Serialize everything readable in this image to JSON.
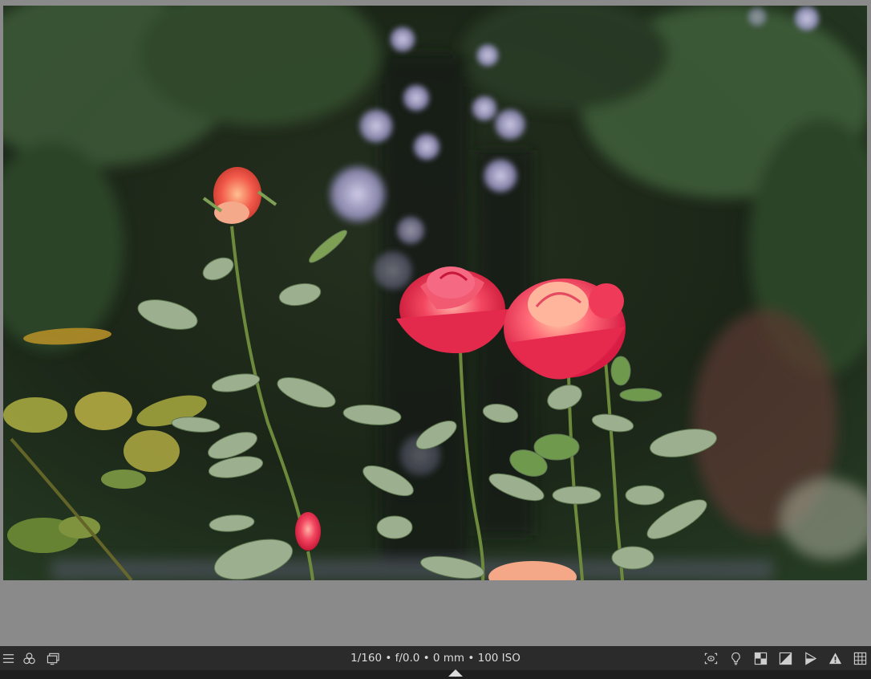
{
  "window": {
    "background": "#5c5c5c"
  },
  "center": {
    "background": "#8a8a8a"
  },
  "image": {
    "subject": "red and pink roses against dark bokeh garden background"
  },
  "bottom_bar": {
    "exif_text": "1/160 • f/0.0 • 0 mm • 100 ISO",
    "left_icons": [
      "hamburger-menu-icon",
      "styles-icon",
      "second-window-icon"
    ],
    "right_icons": [
      "focus-peaking-icon",
      "color-assessment-icon",
      "raw-overexposed-icon",
      "clipping-indicator-icon",
      "softproof-icon",
      "gamut-check-icon",
      "guides-icon"
    ]
  },
  "colors": {
    "bar": "#2b2b2b",
    "text": "#dcdcdc",
    "icon": "#cfcfcf"
  }
}
